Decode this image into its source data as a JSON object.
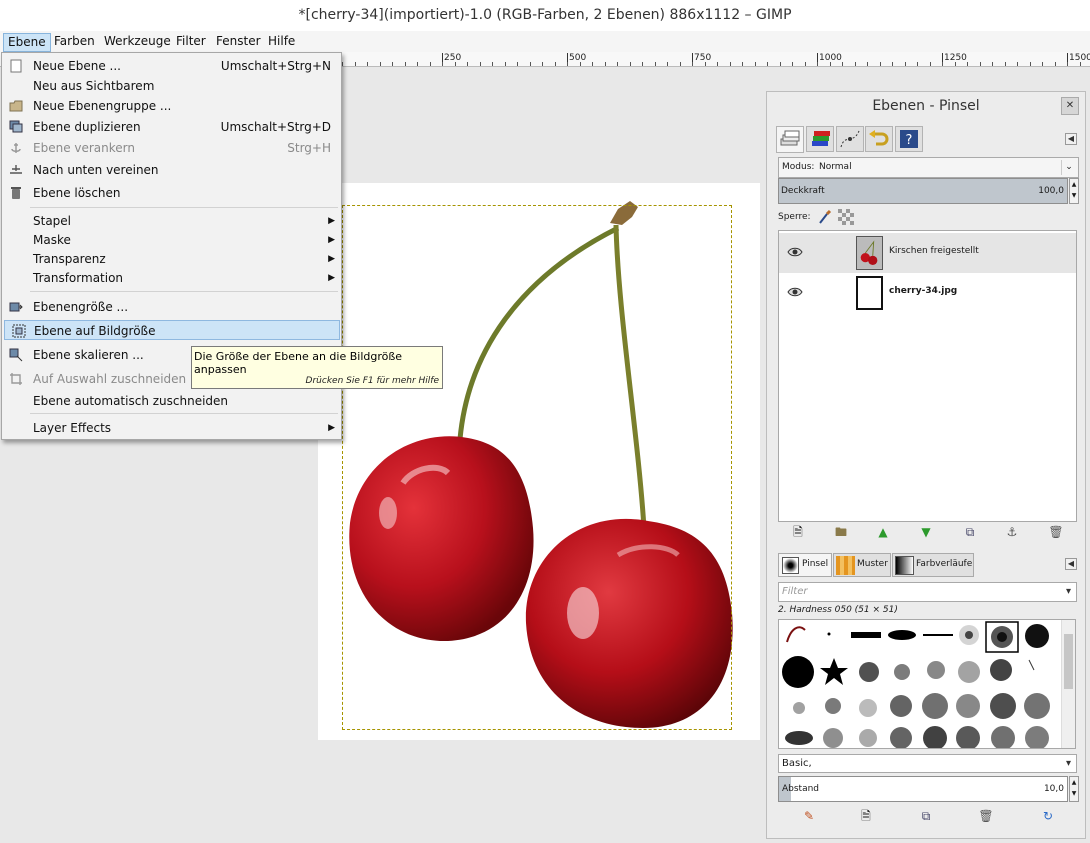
{
  "window": {
    "title": "*[cherry-34](importiert)-1.0 (RGB-Farben, 2 Ebenen) 886x1112 – GIMP"
  },
  "menubar": {
    "items": [
      "Ebene",
      "Farben",
      "Werkzeuge",
      "Filter",
      "Fenster",
      "Hilfe"
    ],
    "active": "Ebene"
  },
  "ruler": {
    "marks": [
      "250",
      "500",
      "750",
      "1000",
      "1250",
      "1500"
    ]
  },
  "layer_menu": {
    "items": [
      {
        "label": "Neue Ebene ...",
        "shortcut": "Umschalt+Strg+N",
        "icon": "new-layer-icon"
      },
      {
        "label": "Neu aus Sichtbarem",
        "shortcut": "",
        "icon": ""
      },
      {
        "label": "Neue Ebenengruppe ...",
        "shortcut": "",
        "icon": "folder-icon"
      },
      {
        "label": "Ebene duplizieren",
        "shortcut": "Umschalt+Strg+D",
        "icon": "duplicate-icon"
      },
      {
        "label": "Ebene verankern",
        "shortcut": "Strg+H",
        "icon": "anchor-icon",
        "disabled": true
      },
      {
        "label": "Nach unten vereinen",
        "shortcut": "",
        "icon": "merge-down-icon"
      },
      {
        "label": "Ebene löschen",
        "shortcut": "",
        "icon": "trash-icon"
      },
      {
        "label": "Stapel",
        "submenu": true
      },
      {
        "label": "Maske",
        "submenu": true
      },
      {
        "label": "Transparenz",
        "submenu": true
      },
      {
        "label": "Transformation",
        "submenu": true
      },
      {
        "label": "Ebenengröße ...",
        "icon": "layer-size-icon"
      },
      {
        "label": "Ebene auf Bildgröße",
        "icon": "layer-to-image-size-icon",
        "highlighted": true
      },
      {
        "label": "Ebene skalieren ...",
        "icon": "scale-icon"
      },
      {
        "label": "Auf Auswahl zuschneiden",
        "icon": "crop-icon",
        "disabled": true
      },
      {
        "label": "Ebene automatisch zuschneiden",
        "icon": ""
      },
      {
        "label": "Layer Effects",
        "submenu": true
      }
    ]
  },
  "tooltip": {
    "text": "Die Größe der Ebene an die Bildgröße anpassen",
    "hint": "Drücken Sie F1 für mehr Hilfe"
  },
  "dock": {
    "title": "Ebenen - Pinsel",
    "mode_label": "Modus:",
    "mode_value": "Normal",
    "opacity_label": "Deckkraft",
    "opacity_value": "100,0",
    "lock_label": "Sperre:",
    "layers": [
      {
        "name": "Kirschen freigestellt",
        "selected": true
      },
      {
        "name": "cherry-34.jpg",
        "bold": true
      }
    ],
    "brush_tabs": [
      "Pinsel",
      "Muster",
      "Farbverläufe"
    ],
    "filter_placeholder": "Filter",
    "brush_selected": "2. Hardness 050 (51 × 51)",
    "brush_preset": "Basic,",
    "spacing_label": "Abstand",
    "spacing_value": "10,0"
  },
  "colors": {
    "menu_highlight": "#cde4f7",
    "tooltip_bg": "#ffffe1",
    "cherry_red": "#c1121b"
  }
}
